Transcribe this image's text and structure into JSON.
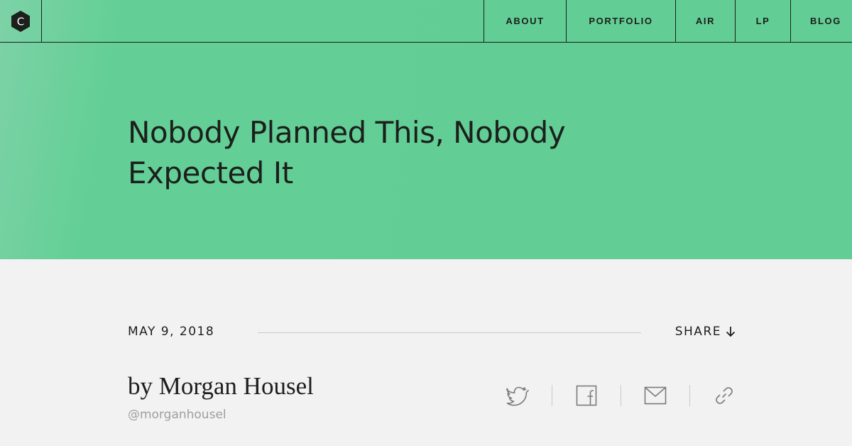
{
  "brand": {
    "logo_letter": "C",
    "logo_name": "logo-icon"
  },
  "nav": {
    "items": [
      {
        "label": "ABOUT"
      },
      {
        "label": "PORTFOLIO"
      },
      {
        "label": "AIR"
      },
      {
        "label": "LP"
      },
      {
        "label": "BLOG"
      }
    ]
  },
  "article": {
    "title_line1": "Nobody Planned This, Nobody",
    "title_line2": "Expected It",
    "date": "MAY 9, 2018",
    "share_label": "SHARE",
    "author": "by Morgan Housel",
    "handle": "@morganhousel"
  },
  "share_icons": [
    "twitter-icon",
    "facebook-icon",
    "mail-icon",
    "link-icon"
  ],
  "colors": {
    "hero_green": "#62ce95",
    "text_dark": "#1c1f1c",
    "background": "#f2f2f2",
    "muted": "#9e9e9e"
  }
}
